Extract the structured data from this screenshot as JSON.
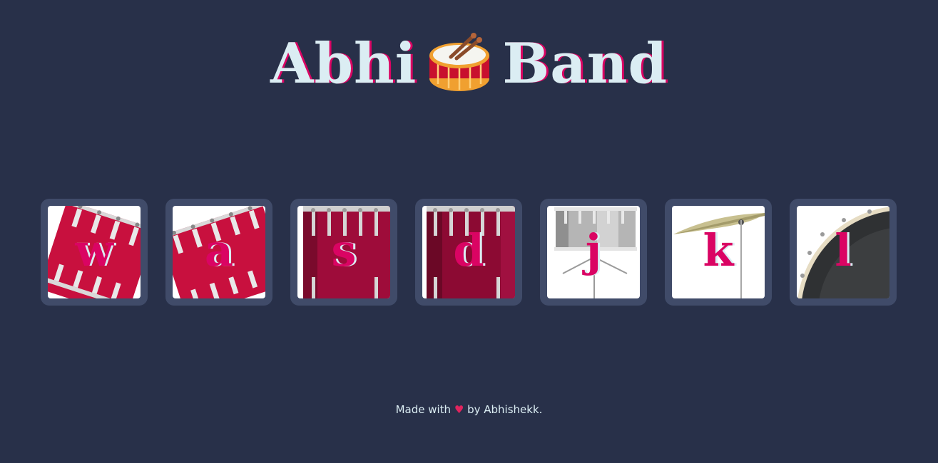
{
  "header": {
    "title_left": "Abhi",
    "title_right": "Band",
    "emoji_icon": "drum-icon"
  },
  "drums": [
    {
      "key": "w",
      "icon": "tom-drum-icon"
    },
    {
      "key": "a",
      "icon": "tom-drum-icon"
    },
    {
      "key": "s",
      "icon": "floor-tom-icon"
    },
    {
      "key": "d",
      "icon": "floor-tom-icon"
    },
    {
      "key": "j",
      "icon": "snare-drum-icon"
    },
    {
      "key": "k",
      "icon": "cymbal-icon"
    },
    {
      "key": "l",
      "icon": "bass-drum-icon"
    }
  ],
  "footer": {
    "prefix": "Made with",
    "heart": "♥",
    "suffix": "by Abhishekk."
  },
  "colors": {
    "background": "#283049",
    "tile": "#404b69",
    "accent": "#da0463",
    "text": "#dbedf3"
  }
}
